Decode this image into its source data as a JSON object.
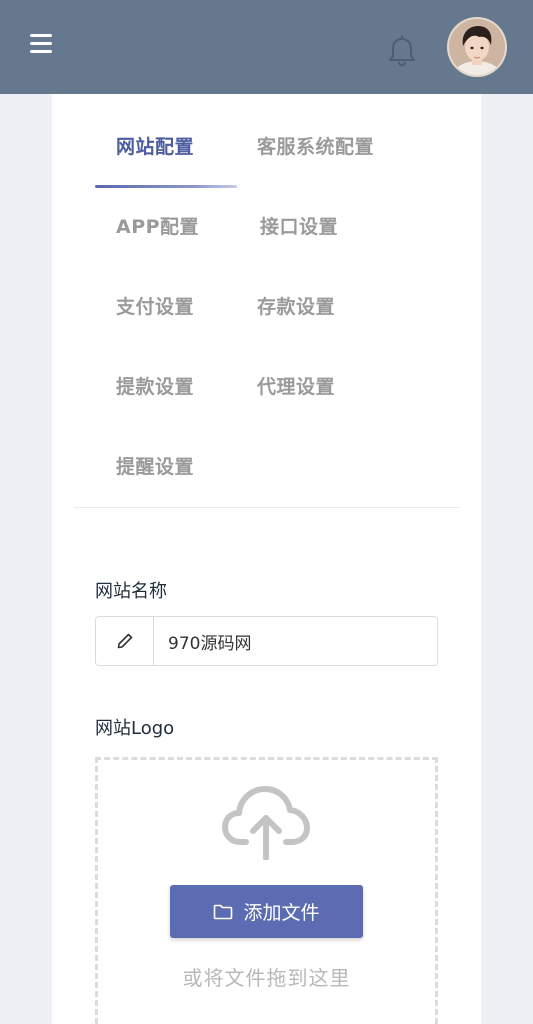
{
  "header": {
    "menu_icon": "hamburger-menu-icon",
    "notification_icon": "bell-icon",
    "avatar": "user-avatar"
  },
  "tabs": {
    "active_index": 0,
    "items": [
      {
        "label": "网站配置"
      },
      {
        "label": "客服系统配置"
      },
      {
        "label": "APP配置"
      },
      {
        "label": "接口设置"
      },
      {
        "label": "支付设置"
      },
      {
        "label": "存款设置"
      },
      {
        "label": "提款设置"
      },
      {
        "label": "代理设置"
      },
      {
        "label": "提醒设置"
      }
    ]
  },
  "form": {
    "site_name": {
      "label": "网站名称",
      "value": "970源码网",
      "icon": "pencil-icon"
    },
    "site_logo": {
      "label": "网站Logo",
      "upload_icon": "cloud-upload-icon",
      "button_icon": "folder-icon",
      "button_label": "添加文件",
      "drop_hint": "或将文件拖到这里"
    }
  },
  "colors": {
    "header_bg": "#66788e",
    "page_bg": "#eef0f5",
    "active_tab": "#4e5d9f",
    "inactive_tab": "#9a9a9a",
    "primary_button": "#5c6cb3"
  }
}
